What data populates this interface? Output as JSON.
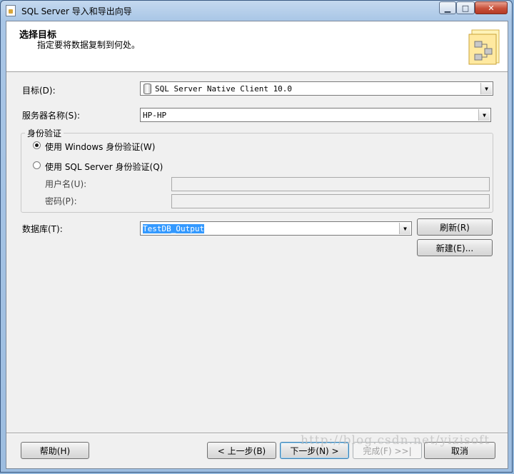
{
  "window": {
    "title": "SQL Server 导入和导出向导",
    "caption": {
      "minimize": "▁",
      "maximize": "□",
      "close": "✕"
    }
  },
  "header": {
    "title": "选择目标",
    "subtitle": "指定要将数据复制到何处。",
    "graphic": "wizard-tables-graphic"
  },
  "form": {
    "destination": {
      "label": "目标(D):",
      "value": "SQL Server Native Client 10.0",
      "icon": "database-icon"
    },
    "server_name": {
      "label": "服务器名称(S):",
      "value": "HP-HP"
    },
    "auth": {
      "legend": "身份验证",
      "windows_label": "使用 Windows 身份验证(W)",
      "sql_label": "使用 SQL Server 身份验证(Q)",
      "selected": "windows",
      "username_label": "用户名(U):",
      "password_label": "密码(P):",
      "username_value": "",
      "password_value": ""
    },
    "database": {
      "label": "数据库(T):",
      "value": "TestDB_Output"
    },
    "refresh_button": "刷新(R)",
    "new_button": "新建(E)..."
  },
  "footer": {
    "help": "帮助(H)",
    "back": "< 上一步(B)",
    "next": "下一步(N) >",
    "finish": "完成(F) >>|",
    "cancel": "取消"
  },
  "watermark": "http://blog.csdn.net/yizisoft"
}
